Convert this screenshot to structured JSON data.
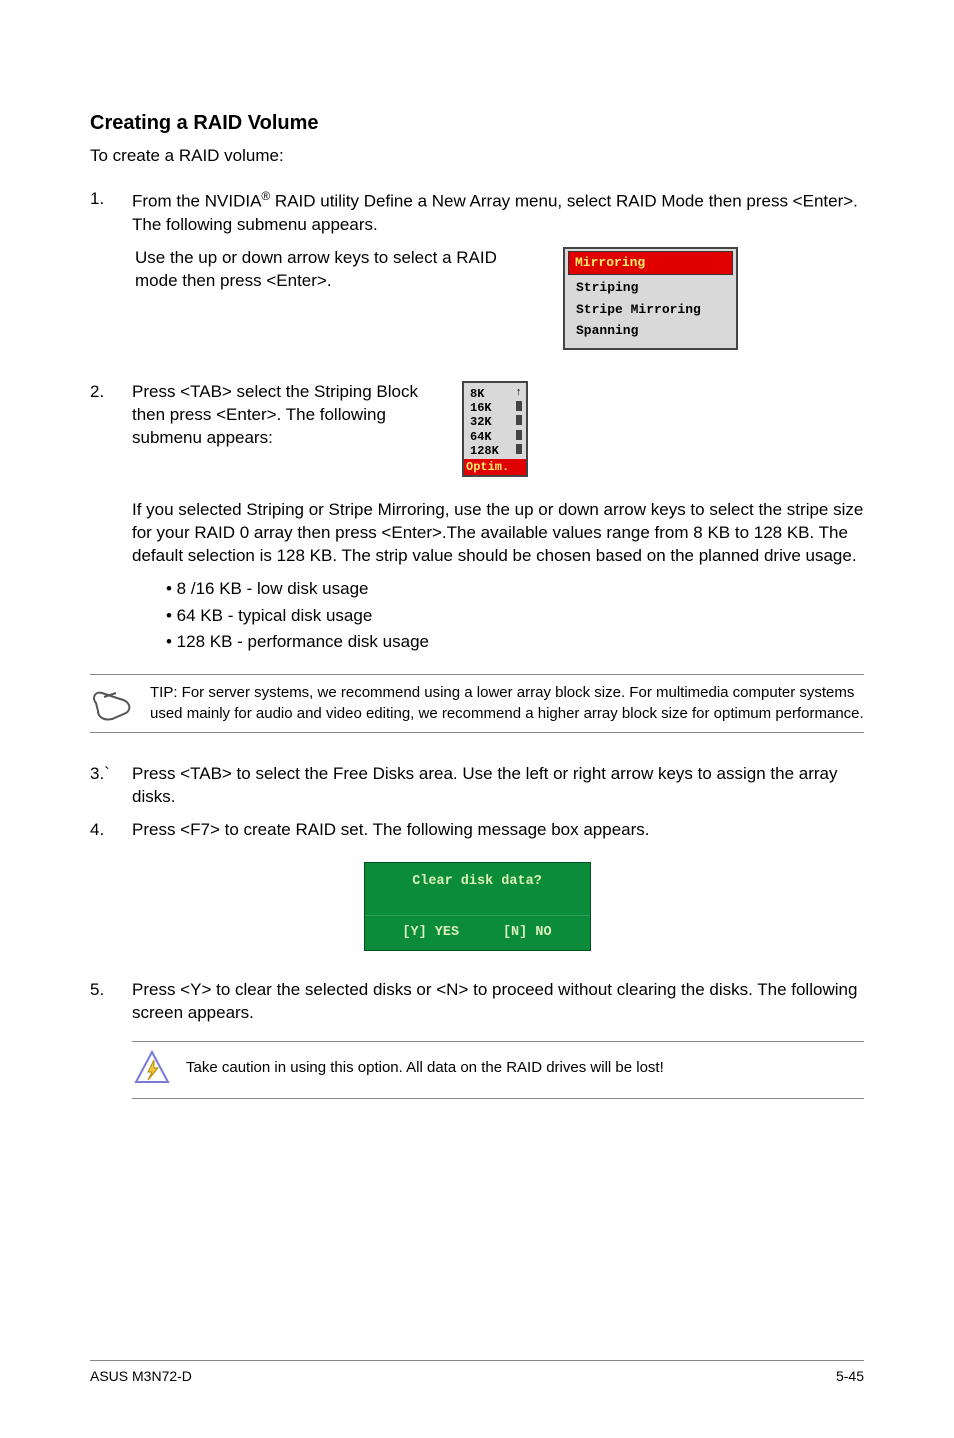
{
  "heading": "Creating a RAID Volume",
  "intro": "To create a RAID volume:",
  "step1": {
    "num": "1.",
    "line1a": "From the NVIDIA",
    "reg": "®",
    "line1b": " RAID utility Define a New Array menu, select RAID Mode then press <Enter>. The following submenu appears.",
    "para2": "Use the up or down arrow keys to select a RAID mode then press <Enter>."
  },
  "raid_modes": {
    "selected": "Mirroring",
    "items": [
      "Striping",
      "Stripe Mirroring",
      "Spanning"
    ]
  },
  "step2": {
    "num": "2.",
    "text": "Press <TAB> select the Striping Block then press <Enter>. The following submenu appears:"
  },
  "stripe_sizes": {
    "items": [
      "8K",
      "16K",
      "32K",
      "64K",
      "128K"
    ],
    "selected": "Optim."
  },
  "stripe_para": "If you selected Striping or Stripe Mirroring, use the up or down arrow keys to select the stripe size for your RAID 0 array then press <Enter>.The available values range from 8 KB to 128 KB. The default selection is 128 KB. The strip value should be chosen based on the planned drive usage.",
  "bullets": [
    "• 8 /16 KB - low disk usage",
    "• 64 KB - typical disk usage",
    "• 128 KB - performance disk usage"
  ],
  "tip": "TIP: For server systems, we recommend using a lower array block size. For multimedia computer systems used mainly for audio and video editing, we recommend a higher array block size for optimum performance.",
  "step3": {
    "num": "3.`",
    "text": "Press <TAB> to select the Free Disks area. Use the left or right arrow keys to assign the array disks."
  },
  "step4": {
    "num": "4.",
    "text": "Press <F7> to create RAID set. The following message box appears."
  },
  "dialog": {
    "title": "Clear disk data?",
    "yes": "[Y] YES",
    "no": "[N] NO"
  },
  "step5": {
    "num": "5.",
    "text": "Press <Y> to clear the selected disks or <N> to proceed without clearing the disks. The following screen appears."
  },
  "caution": "Take caution in using this option. All data on the RAID drives will be lost!",
  "footer": {
    "left": "ASUS M3N72-D",
    "right": "5-45"
  }
}
